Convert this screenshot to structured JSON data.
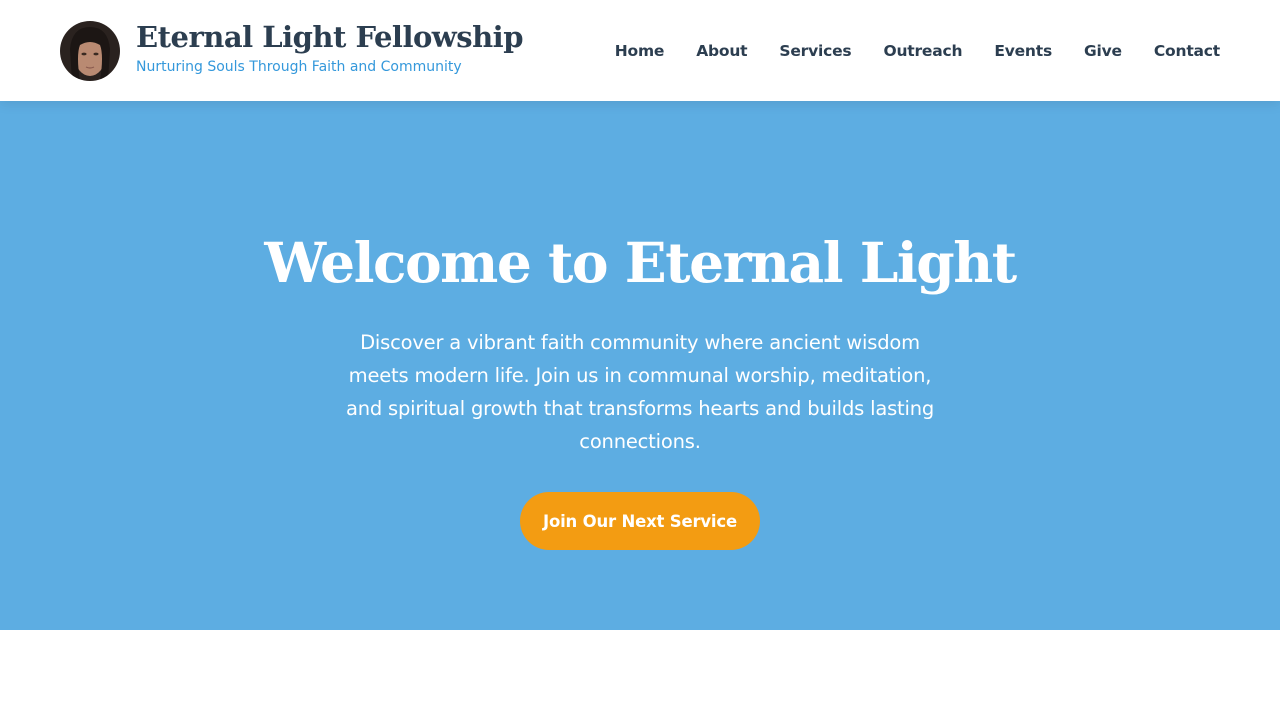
{
  "brand": {
    "title": "Eternal Light Fellowship",
    "tagline": "Nurturing Souls Through Faith and Community"
  },
  "nav": {
    "items": [
      "Home",
      "About",
      "Services",
      "Outreach",
      "Events",
      "Give",
      "Contact"
    ]
  },
  "hero": {
    "title": "Welcome to Eternal Light",
    "description": "Discover a vibrant faith community where ancient wisdom meets modern life. Join us in communal worship, meditation, and spiritual growth that transforms hearts and builds lasting connections.",
    "cta_label": "Join Our Next Service"
  },
  "colors": {
    "hero_background": "#5dade2",
    "accent": "#f39c12",
    "heading": "#2c3e50",
    "tagline": "#3498db"
  }
}
